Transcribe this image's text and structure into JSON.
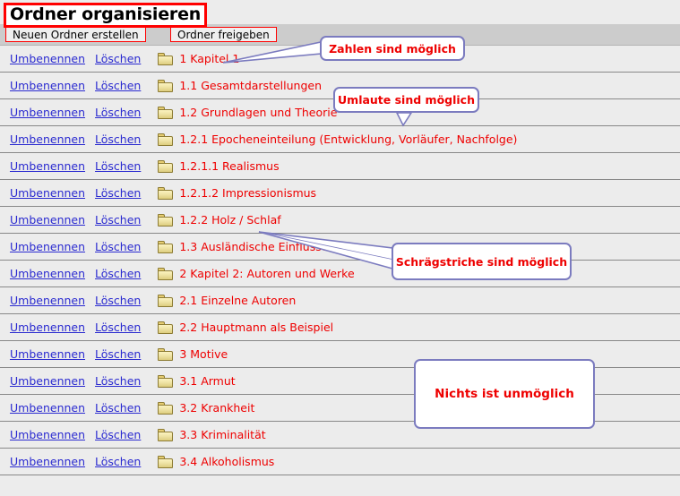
{
  "page": {
    "title": "Ordner organisieren",
    "title_border_color": "#ff0000",
    "body_bg": "#ececec",
    "toolbar_bg": "#cccccc",
    "folder_name_color": "#ee0000",
    "link_color": "#2a2ad0",
    "callout_border_color": "#7b7bbf",
    "callout_text_color": "#ee0000"
  },
  "toolbar": {
    "new_folder_label": "Neuen Ordner erstellen",
    "share_folder_label": "Ordner freigeben"
  },
  "row_actions": {
    "rename_label": "Umbenennen",
    "delete_label": "Löschen",
    "folder_icon": "folder-icon"
  },
  "folders": [
    {
      "name": "1 Kapitel 1"
    },
    {
      "name": "1.1 Gesamtdarstellungen"
    },
    {
      "name": "1.2 Grundlagen und Theorie"
    },
    {
      "name": "1.2.1 Epocheneinteilung (Entwicklung, Vorläufer, Nachfolge)"
    },
    {
      "name": "1.2.1.1 Realismus"
    },
    {
      "name": "1.2.1.2 Impressionismus"
    },
    {
      "name": "1.2.2 Holz / Schlaf"
    },
    {
      "name": "1.3 Ausländische Einflüsse"
    },
    {
      "name": "2 Kapitel 2: Autoren und Werke"
    },
    {
      "name": "2.1 Einzelne Autoren"
    },
    {
      "name": "2.2 Hauptmann als Beispiel"
    },
    {
      "name": "3 Motive"
    },
    {
      "name": "3.1 Armut"
    },
    {
      "name": "3.2 Krankheit"
    },
    {
      "name": "3.3 Kriminalität"
    },
    {
      "name": "3.4 Alkoholismus"
    }
  ],
  "callouts": [
    {
      "id": "zahlen",
      "text": "Zahlen sind möglich"
    },
    {
      "id": "umlaute",
      "text": "Umlaute sind möglich"
    },
    {
      "id": "schraeg",
      "text": "Schrägstriche sind möglich"
    },
    {
      "id": "nichts",
      "text": "Nichts ist unmöglich"
    }
  ]
}
